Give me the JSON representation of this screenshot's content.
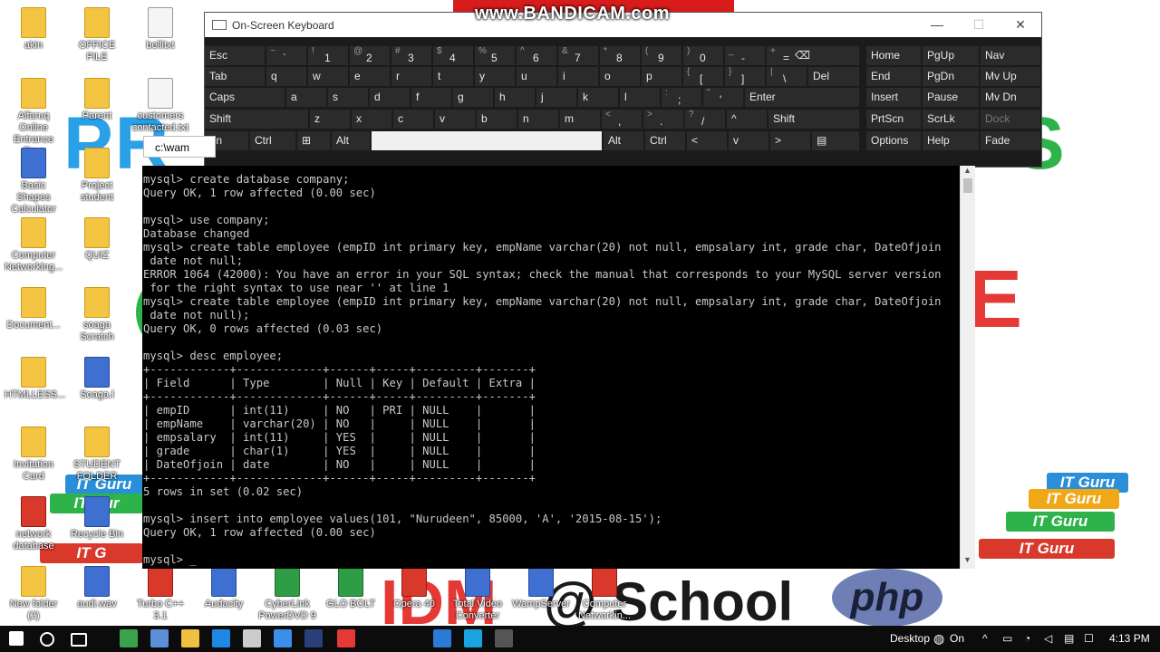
{
  "watermark": "www.BANDICAM.com",
  "background": {
    "pr_text": "PR",
    "s_text": "S",
    "e_text": "E",
    "php_text": "php",
    "idm_text": "IDM",
    "school_text": "@ School",
    "books": [
      "IT Guru",
      "IT Guru",
      "IT Guru",
      "IT Guru"
    ],
    "books_left": [
      "IT Guru",
      "IT Gur",
      "IT G"
    ]
  },
  "desktop_icons": [
    {
      "label": "akin",
      "kind": "folder"
    },
    {
      "label": "OFFICE FILE",
      "kind": "folder"
    },
    {
      "label": "bellitxt",
      "kind": "doc"
    },
    {
      "label": "Alfaruq Online Entrance Ex...",
      "kind": "folder"
    },
    {
      "label": "Parent",
      "kind": "folder"
    },
    {
      "label": "customers contacted.txt",
      "kind": "doc"
    },
    {
      "label": "Basic Shapes Calculator",
      "kind": "app"
    },
    {
      "label": "Project student",
      "kind": "folder"
    },
    {
      "label": "Computer Networking...",
      "kind": "folder"
    },
    {
      "label": "QUIZ",
      "kind": "folder"
    },
    {
      "label": "Document...",
      "kind": "folder"
    },
    {
      "label": "soaga Scratch",
      "kind": "folder"
    },
    {
      "label": "HTMLLESS...",
      "kind": "folder"
    },
    {
      "label": "Soaga.l",
      "kind": "app"
    },
    {
      "label": "Invitation Card",
      "kind": "folder"
    },
    {
      "label": "STUDENT FOLDER",
      "kind": "folder"
    },
    {
      "label": "network database",
      "kind": "red"
    },
    {
      "label": "Recycle Bin",
      "kind": "app"
    },
    {
      "label": "New folder (2)",
      "kind": "folder"
    },
    {
      "label": "audi.wav",
      "kind": "app"
    },
    {
      "label": "Turbo C++ 3.1",
      "kind": "red"
    },
    {
      "label": "Audacity",
      "kind": "app"
    },
    {
      "label": "CyberLink PowerDVD 9",
      "kind": "green"
    },
    {
      "label": "GLO BOLT",
      "kind": "green"
    },
    {
      "label": "Opera 40",
      "kind": "red"
    },
    {
      "label": "Total Video Converter",
      "kind": "app"
    },
    {
      "label": "WampServer",
      "kind": "app"
    },
    {
      "label": "Computer Networkin...",
      "kind": "red"
    }
  ],
  "osk": {
    "title": "On-Screen Keyboard",
    "minimize": "—",
    "maximize": "☐",
    "close": "✕",
    "row1": [
      {
        "main": "Esc"
      },
      {
        "alt": "~",
        "main": "`"
      },
      {
        "alt": "!",
        "main": "1"
      },
      {
        "alt": "@",
        "main": "2"
      },
      {
        "alt": "#",
        "main": "3"
      },
      {
        "alt": "$",
        "main": "4"
      },
      {
        "alt": "%",
        "main": "5"
      },
      {
        "alt": "^",
        "main": "6"
      },
      {
        "alt": "&",
        "main": "7"
      },
      {
        "alt": "*",
        "main": "8"
      },
      {
        "alt": "(",
        "main": "9"
      },
      {
        "alt": ")",
        "main": "0"
      },
      {
        "alt": "_",
        "main": "-"
      },
      {
        "alt": "+",
        "main": "="
      },
      {
        "main": "⌫"
      }
    ],
    "row2": [
      {
        "main": "Tab"
      },
      {
        "main": "q"
      },
      {
        "main": "w"
      },
      {
        "main": "e"
      },
      {
        "main": "r"
      },
      {
        "main": "t"
      },
      {
        "main": "y"
      },
      {
        "main": "u"
      },
      {
        "main": "i"
      },
      {
        "main": "o"
      },
      {
        "main": "p"
      },
      {
        "alt": "{",
        "main": "["
      },
      {
        "alt": "}",
        "main": "]"
      },
      {
        "alt": "|",
        "main": "\\"
      },
      {
        "main": "Del"
      }
    ],
    "row3": [
      {
        "main": "Caps"
      },
      {
        "main": "a"
      },
      {
        "main": "s"
      },
      {
        "main": "d"
      },
      {
        "main": "f"
      },
      {
        "main": "g"
      },
      {
        "main": "h"
      },
      {
        "main": "j"
      },
      {
        "main": "k"
      },
      {
        "main": "l"
      },
      {
        "alt": ":",
        "main": ";"
      },
      {
        "alt": "\"",
        "main": "'"
      },
      {
        "main": "Enter"
      }
    ],
    "row4": [
      {
        "main": "Shift"
      },
      {
        "main": "z"
      },
      {
        "main": "x"
      },
      {
        "main": "c"
      },
      {
        "main": "v"
      },
      {
        "main": "b"
      },
      {
        "main": "n"
      },
      {
        "main": "m"
      },
      {
        "alt": "<",
        "main": ","
      },
      {
        "alt": ">",
        "main": "."
      },
      {
        "alt": "?",
        "main": "/"
      },
      {
        "main": "^"
      },
      {
        "main": "Shift"
      }
    ],
    "row5": [
      {
        "main": "Fn"
      },
      {
        "main": "Ctrl"
      },
      {
        "main": "⊞"
      },
      {
        "main": "Alt"
      },
      {
        "main": ""
      },
      {
        "main": "Alt"
      },
      {
        "main": "Ctrl"
      },
      {
        "main": "<"
      },
      {
        "main": "v"
      },
      {
        "main": ">"
      },
      {
        "main": "▤"
      }
    ],
    "nav": [
      [
        "Home",
        "PgUp",
        "Nav"
      ],
      [
        "End",
        "PgDn",
        "Mv Up"
      ],
      [
        "Insert",
        "Pause",
        "Mv Dn"
      ],
      [
        "PrtScn",
        "ScrLk",
        "Dock"
      ],
      [
        "Options",
        "Help",
        "Fade"
      ]
    ]
  },
  "console": {
    "tab_title": "c:\\wam",
    "lines": [
      "mysql> create database company;",
      "Query OK, 1 row affected (0.00 sec)",
      "",
      "mysql> use company;",
      "Database changed",
      "mysql> create table employee (empID int primary key, empName varchar(20) not null, empsalary int, grade char, DateOfjoin",
      " date not null;",
      "ERROR 1064 (42000): You have an error in your SQL syntax; check the manual that corresponds to your MySQL server version",
      " for the right syntax to use near '' at line 1",
      "mysql> create table employee (empID int primary key, empName varchar(20) not null, empsalary int, grade char, DateOfjoin",
      " date not null);",
      "Query OK, 0 rows affected (0.03 sec)",
      "",
      "mysql> desc employee;",
      "+------------+-------------+------+-----+---------+-------+",
      "| Field      | Type        | Null | Key | Default | Extra |",
      "+------------+-------------+------+-----+---------+-------+",
      "| empID      | int(11)     | NO   | PRI | NULL    |       |",
      "| empName    | varchar(20) | NO   |     | NULL    |       |",
      "| empsalary  | int(11)     | YES  |     | NULL    |       |",
      "| grade      | char(1)     | YES  |     | NULL    |       |",
      "| DateOfjoin | date        | NO   |     | NULL    |       |",
      "+------------+-------------+------+-----+---------+-------+",
      "5 rows in set (0.02 sec)",
      "",
      "mysql> insert into employee values(101, \"Nurudeen\", 85000, 'A', '2015-08-15');",
      "Query OK, 1 row affected (0.00 sec)",
      "",
      "mysql> _"
    ]
  },
  "taskbar": {
    "desktop_label": "Desktop",
    "on_label": "On",
    "time": "4:13 PM",
    "apps": [
      "start-icon",
      "search-icon",
      "task-view-icon",
      "camtasia-icon",
      "keyboard-icon",
      "file-explorer-icon",
      "edge-icon",
      "store-icon",
      "ie-icon",
      "photoshop-icon",
      "opera-icon",
      "vscode-icon",
      "skype-icon",
      "console-icon"
    ]
  }
}
